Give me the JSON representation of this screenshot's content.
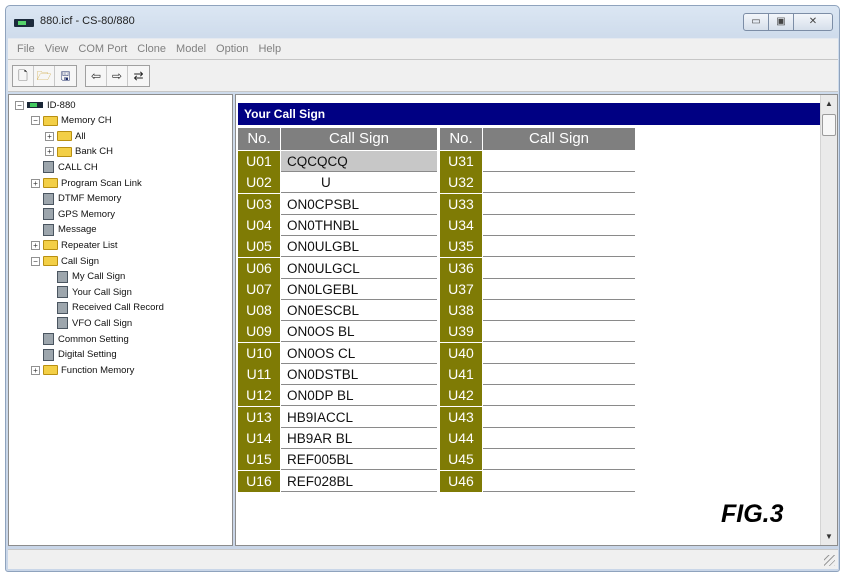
{
  "window": {
    "title": "880.icf - CS-80/880",
    "controls": {
      "minimize": "▭",
      "maximize": "▣",
      "close": "✕"
    }
  },
  "menu": [
    "File",
    "View",
    "COM Port",
    "Clone",
    "Model",
    "Option",
    "Help"
  ],
  "toolbar": {
    "file_buttons": [
      {
        "icon": "new-document-icon",
        "glyph": "🗋"
      },
      {
        "icon": "open-folder-icon",
        "glyph": "🗁"
      },
      {
        "icon": "save-disk-icon",
        "glyph": "🖫"
      }
    ],
    "clone_buttons": [
      {
        "icon": "read-from-radio-icon",
        "glyph": "⇦"
      },
      {
        "icon": "write-to-radio-icon",
        "glyph": "⇨"
      },
      {
        "icon": "radio-info-icon",
        "glyph": "⇄"
      }
    ]
  },
  "tree": [
    {
      "label": "ID-880",
      "icon": "radio",
      "expander": "−",
      "level": 0
    },
    {
      "label": "Memory CH",
      "icon": "folder",
      "expander": "−",
      "level": 1
    },
    {
      "label": "All",
      "icon": "folder",
      "expander": "+",
      "level": 2
    },
    {
      "label": "Bank CH",
      "icon": "folder",
      "expander": "+",
      "level": 2
    },
    {
      "label": "CALL CH",
      "icon": "doc",
      "expander": "",
      "level": 1
    },
    {
      "label": "Program Scan Link",
      "icon": "folder",
      "expander": "+",
      "level": 1
    },
    {
      "label": "DTMF Memory",
      "icon": "doc",
      "expander": "",
      "level": 1
    },
    {
      "label": "GPS Memory",
      "icon": "doc",
      "expander": "",
      "level": 1
    },
    {
      "label": "Message",
      "icon": "doc",
      "expander": "",
      "level": 1
    },
    {
      "label": "Repeater List",
      "icon": "folder",
      "expander": "+",
      "level": 1
    },
    {
      "label": "Call Sign",
      "icon": "folder",
      "expander": "−",
      "level": 1
    },
    {
      "label": "My Call Sign",
      "icon": "doc",
      "expander": "",
      "level": 2
    },
    {
      "label": "Your Call Sign",
      "icon": "doc",
      "expander": "",
      "level": 2
    },
    {
      "label": "Received Call Record",
      "icon": "doc",
      "expander": "",
      "level": 2
    },
    {
      "label": "VFO Call Sign",
      "icon": "doc",
      "expander": "",
      "level": 2
    },
    {
      "label": "Common Setting",
      "icon": "doc",
      "expander": "",
      "level": 1
    },
    {
      "label": "Digital Setting",
      "icon": "doc",
      "expander": "",
      "level": 1
    },
    {
      "label": "Function Memory",
      "icon": "folder",
      "expander": "+",
      "level": 1
    }
  ],
  "panel": {
    "title": "Your Call Sign",
    "headers": {
      "no": "No.",
      "call_sign": "Call Sign"
    },
    "left_rows": [
      {
        "no": "U01",
        "call": "CQCQCQ",
        "selected": true
      },
      {
        "no": "U02",
        "call": "U"
      },
      {
        "no": "U03",
        "call": "ON0CPSBL"
      },
      {
        "no": "U04",
        "call": "ON0THNBL"
      },
      {
        "no": "U05",
        "call": "ON0ULGBL"
      },
      {
        "no": "U06",
        "call": "ON0ULGCL"
      },
      {
        "no": "U07",
        "call": "ON0LGEBL"
      },
      {
        "no": "U08",
        "call": "ON0ESCBL"
      },
      {
        "no": "U09",
        "call": "ON0OS BL"
      },
      {
        "no": "U10",
        "call": "ON0OS CL"
      },
      {
        "no": "U11",
        "call": "ON0DSTBL"
      },
      {
        "no": "U12",
        "call": "ON0DP BL"
      },
      {
        "no": "U13",
        "call": "HB9IACCL"
      },
      {
        "no": "U14",
        "call": "HB9AR BL"
      },
      {
        "no": "U15",
        "call": "REF005BL"
      },
      {
        "no": "U16",
        "call": "REF028BL"
      }
    ],
    "right_rows": [
      {
        "no": "U31",
        "call": ""
      },
      {
        "no": "U32",
        "call": ""
      },
      {
        "no": "U33",
        "call": ""
      },
      {
        "no": "U34",
        "call": ""
      },
      {
        "no": "U35",
        "call": ""
      },
      {
        "no": "U36",
        "call": ""
      },
      {
        "no": "U37",
        "call": ""
      },
      {
        "no": "U38",
        "call": ""
      },
      {
        "no": "U39",
        "call": ""
      },
      {
        "no": "U40",
        "call": ""
      },
      {
        "no": "U41",
        "call": ""
      },
      {
        "no": "U42",
        "call": ""
      },
      {
        "no": "U43",
        "call": ""
      },
      {
        "no": "U44",
        "call": ""
      },
      {
        "no": "U45",
        "call": ""
      },
      {
        "no": "U46",
        "call": ""
      }
    ],
    "figure_label": "FIG.3"
  },
  "scrollbar": {
    "up": "▲",
    "down": "▼"
  },
  "colors": {
    "header_bar": "#000083",
    "row_number_bg": "#7f7b05",
    "column_header_bg": "#7f7f7f",
    "selected_row_bg": "#c7c7c7"
  }
}
